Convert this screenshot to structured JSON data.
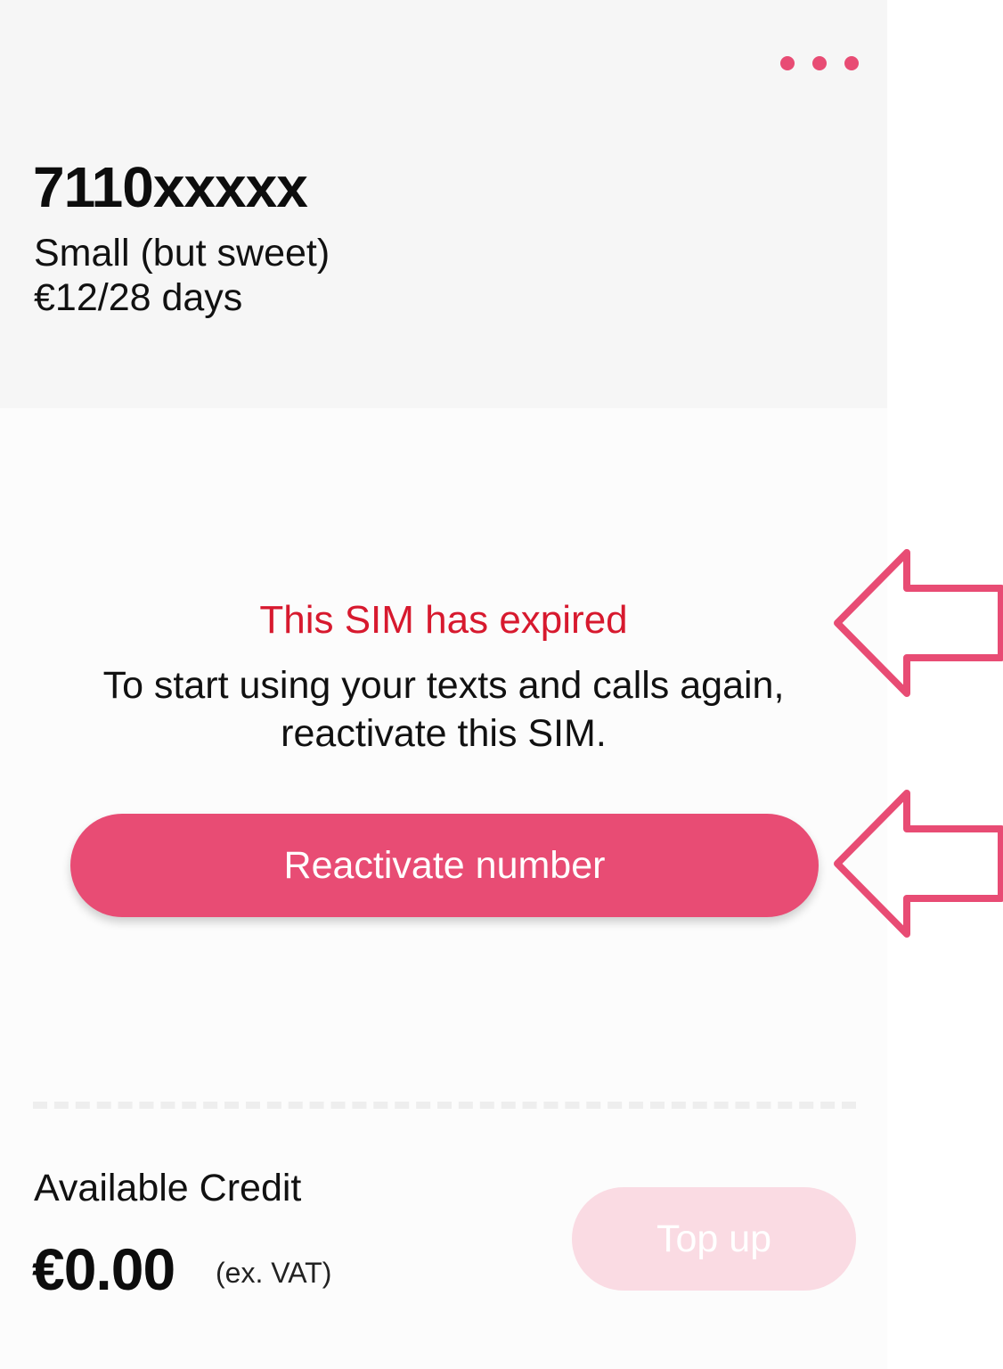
{
  "header": {
    "phone_number": "7110xxxxx",
    "plan_name": "Small (but sweet)",
    "plan_price": "€12/28 days",
    "more_menu_icon": "more-horizontal-icon"
  },
  "status": {
    "title": "This SIM has expired",
    "message": "To start using your texts and calls again, reactivate this SIM.",
    "reactivate_label": "Reactivate number"
  },
  "credit": {
    "label": "Available Credit",
    "amount": "€0.00",
    "vat_note": "(ex. VAT)",
    "topup_label": "Top up",
    "topup_enabled": false
  },
  "annotations": {
    "arrow_icon": "arrow-left-outline-icon",
    "arrow_color": "#e84c74"
  },
  "colors": {
    "accent": "#e84c74",
    "error": "#d7192e",
    "header_bg": "#f6f6f6",
    "disabled_button": "#fadbe3"
  }
}
